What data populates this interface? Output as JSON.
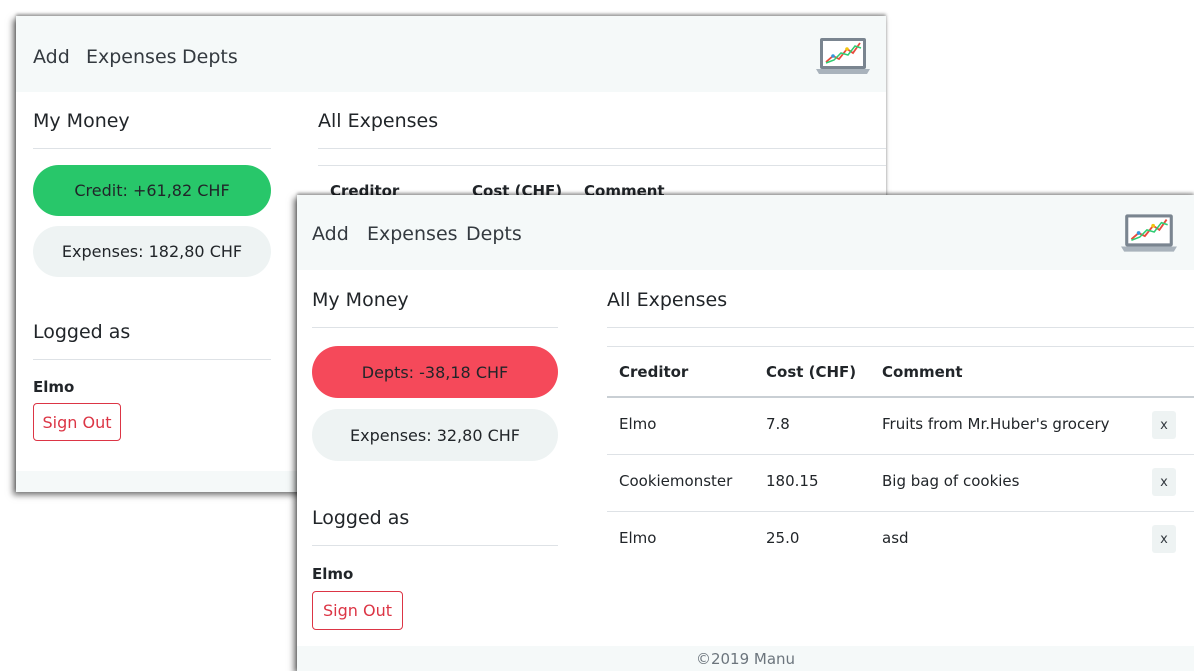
{
  "nav": {
    "items": [
      {
        "label": "Add"
      },
      {
        "label": "Expenses"
      },
      {
        "label": "Depts"
      }
    ],
    "logo_icon": "laptop-chart-icon"
  },
  "window_back": {
    "money": {
      "title": "My Money",
      "balance_label": "Credit: +61,82 CHF",
      "expenses_label": "Expenses: 182,80 CHF",
      "balance_color": "#28c76a"
    },
    "logged": {
      "title": "Logged as",
      "user": "Elmo",
      "signout_label": "Sign Out"
    },
    "expenses": {
      "title": "All Expenses",
      "columns": [
        "Creditor",
        "Cost (CHF)",
        "Comment"
      ]
    }
  },
  "window_front": {
    "money": {
      "title": "My Money",
      "balance_label": "Depts: -38,18 CHF",
      "expenses_label": "Expenses: 32,80 CHF",
      "balance_color": "#f5495a"
    },
    "logged": {
      "title": "Logged as",
      "user": "Elmo",
      "signout_label": "Sign Out"
    },
    "expenses": {
      "title": "All Expenses",
      "columns": [
        "Creditor",
        "Cost (CHF)",
        "Comment"
      ],
      "rows": [
        {
          "creditor": "Elmo",
          "cost": "7.8",
          "comment": "Fruits from Mr.Huber's grocery",
          "delete_label": "x"
        },
        {
          "creditor": "Cookiemonster",
          "cost": "180.15",
          "comment": "Big bag of cookies",
          "delete_label": "x"
        },
        {
          "creditor": "Elmo",
          "cost": "25.0",
          "comment": "asd",
          "delete_label": "x"
        }
      ]
    },
    "footer": "©2019 Manu"
  }
}
